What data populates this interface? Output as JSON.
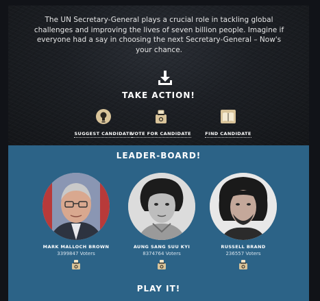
{
  "hero": {
    "intro_text": "The UN Secretary-General plays a crucial role in tackling global challenges and improving the lives of seven billion people. Imagine if everyone had a say in choosing the next Secretary-General – Now's your chance.",
    "download_icon": "download-arrow-icon",
    "take_action_label": "TAKE ACTION!",
    "actions": [
      {
        "label": "SUGGEST CANDIDATE",
        "icon": "lightbulb-icon"
      },
      {
        "label": "VOTE FOR CANDIDATE",
        "icon": "ballot-icon"
      },
      {
        "label": "FIND CANDIDATE",
        "icon": "book-icon"
      }
    ]
  },
  "leaderboard": {
    "title": "LEADER-BOARD!",
    "candidates": [
      {
        "name": "MARK MALLOCH BROWN",
        "voters": "3399847 Voters"
      },
      {
        "name": "AUNG SANG SUU KYI",
        "voters": "8374764 Voters"
      },
      {
        "name": "RUSSELL BRAND",
        "voters": "236557 Voters"
      }
    ],
    "play_label": "PLAY IT!"
  },
  "colors": {
    "board_blue": "#2c6387",
    "hero_dark": "#1c1f24",
    "icon_tan": "#d9c49a"
  }
}
